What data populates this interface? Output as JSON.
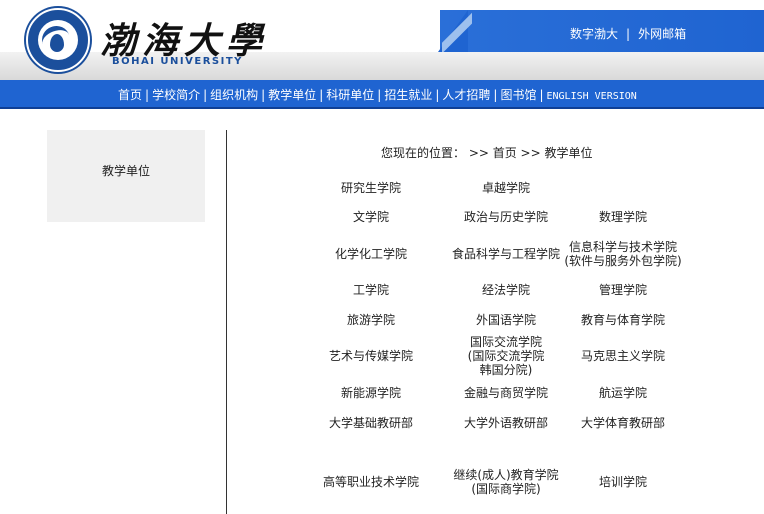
{
  "header": {
    "logo_text": "渤海大學",
    "logo_subtitle": "BOHAI UNIVERSITY",
    "seal_text": "渤海大學 1950 BOHAI UNIVERSITY",
    "top_links": [
      "数字渤大",
      "外网邮箱"
    ],
    "top_sep": "|"
  },
  "nav": {
    "items": [
      "首页",
      "学校简介",
      "组织机构",
      "教学单位",
      "科研单位",
      "招生就业",
      "人才招聘",
      "图书馆",
      "ENGLISH VERSION"
    ],
    "sep": "|"
  },
  "sidebar": {
    "title": "教学单位"
  },
  "breadcrumb": {
    "text": "您现在的位置： >> 首页 >> 教学单位"
  },
  "units": [
    "研究生学院",
    "卓越学院",
    "文学院",
    "政治与历史学院",
    "数理学院",
    "化学化工学院",
    "食品科学与工程学院",
    "信息科学与技术学院\n(软件与服务外包学院)",
    "工学院",
    "经法学院",
    "管理学院",
    "旅游学院",
    "外国语学院",
    "教育与体育学院",
    "艺术与传媒学院",
    "国际交流学院\n(国际交流学院\n韩国分院)",
    "马克思主义学院",
    "新能源学院",
    "金融与商贸学院",
    "航运学院",
    "大学基础教研部",
    "大学外语教研部",
    "大学体育教研部",
    "高等职业技术学院",
    "继续(成人)教育学院\n(国际商学院)",
    "培训学院"
  ],
  "colors": {
    "nav_blue": "#1f64d1",
    "header_blue": "#2a6fd8",
    "sidebar_bg": "#f0f0f0"
  }
}
